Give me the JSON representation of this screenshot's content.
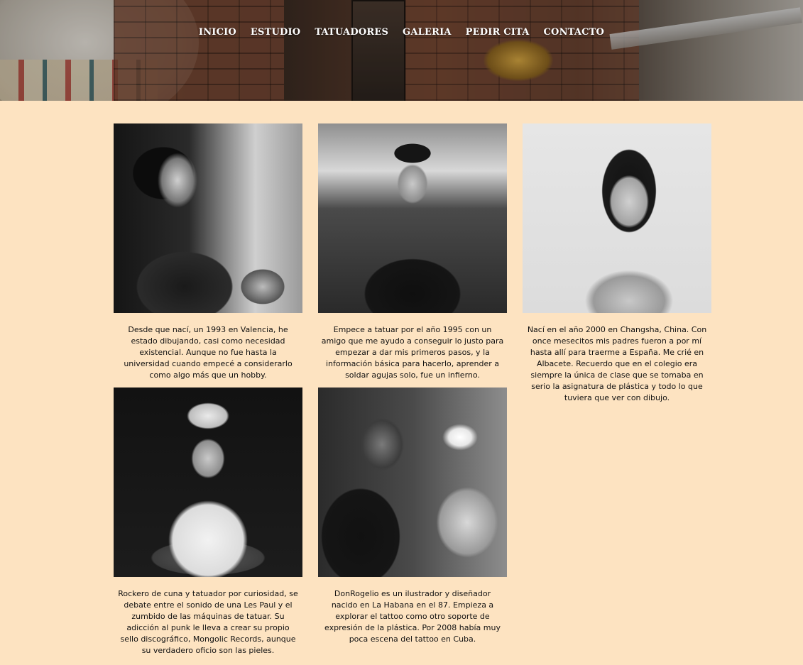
{
  "nav": {
    "items": [
      "INICIO",
      "ESTUDIO",
      "TATUADORES",
      "GALERIA",
      "PEDIR CITA",
      "CONTACTO"
    ]
  },
  "artists": [
    {
      "bio": "Desde que nací, un 1993 en Valencia, he estado dibujando, casi como necesidad existencial. Aunque no fue hasta la universidad cuando empecé a considerarlo como algo más que un hobby."
    },
    {
      "bio": "Empece a tatuar por el año 1995 con un amigo que me ayudo a conseguir lo justo para empezar a dar mis primeros pasos, y la información básica para hacerlo, aprender a soldar agujas solo, fue un infierno."
    },
    {
      "bio": "Nací en el año 2000 en Changsha, China. Con once mesecitos mis padres fueron a por mí hasta allí para traerme a España. Me crié en Albacete. Recuerdo que en el colegio era siempre la única de clase que se tomaba en serio la asignatura de plástica y todo lo que tuviera que ver con dibujo."
    },
    {
      "bio": "Rockero de cuna y tatuador por curiosidad, se debate entre el sonido de una Les Paul y el zumbido de las máquinas de tatuar. Su adicción al punk le lleva a crear su propio sello discográfico, Mongolic Records, aunque su verdadero oficio son las pieles."
    },
    {
      "bio": "DonRogelio es un ilustrador y diseñador nacido en La Habana en el 87. Empieza a explorar el tattoo como otro soporte de expresión de la plástica. Por 2008 había muy poca escena del tattoo en Cuba."
    }
  ]
}
